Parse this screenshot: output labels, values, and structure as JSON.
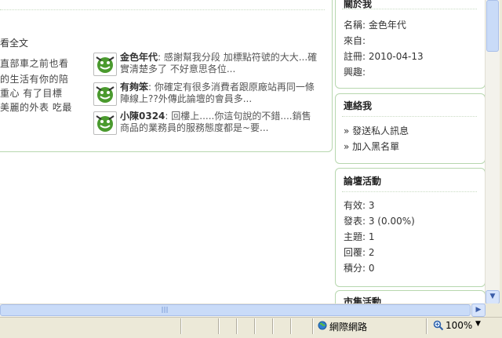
{
  "main": {
    "read_all": "看全文",
    "body_lines": [
      "直部車之前也看",
      "的生活有你的陪",
      "重心 有了目標",
      "美麗的外表 吃最"
    ],
    "comments": [
      {
        "author": "金色年代",
        "text1": ": 感謝幫我分段 加標點符號的大大...確",
        "text2": "實清楚多了 不好意思各位..."
      },
      {
        "author": "有夠笨",
        "text1": ": 你確定有很多消費者跟原廠站再同一條",
        "text2": "陣線上??外傳此論壇的會員多..."
      },
      {
        "author": "小陳0324",
        "text1": ": 回樓上.....你這句說的不錯....銷售",
        "text2": "商品的業務員的服務態度都是~要..."
      }
    ]
  },
  "profile": {
    "title": "關於我",
    "name": "名稱: 金色年代",
    "from": "來自:",
    "registered": "註冊: 2010-04-13",
    "interests": "興趣:"
  },
  "contact": {
    "title": "連絡我",
    "send_message": "» 發送私人訊息",
    "blacklist": "» 加入黑名單"
  },
  "forum": {
    "title": "論壇活動",
    "valid": "有效: 3",
    "posts": "發表: 3 (0.00%)",
    "topics": "主題: 1",
    "replies": "回覆: 2",
    "points": "積分: 0"
  },
  "market": {
    "title": "市集活動"
  },
  "statusbar": {
    "zone": "網際網路",
    "zoom": "100%"
  },
  "colors": {
    "box_border": "#b7d7ae",
    "avatar_green": "#4a9a2e",
    "scroll_blue": "#c9dbf8"
  }
}
